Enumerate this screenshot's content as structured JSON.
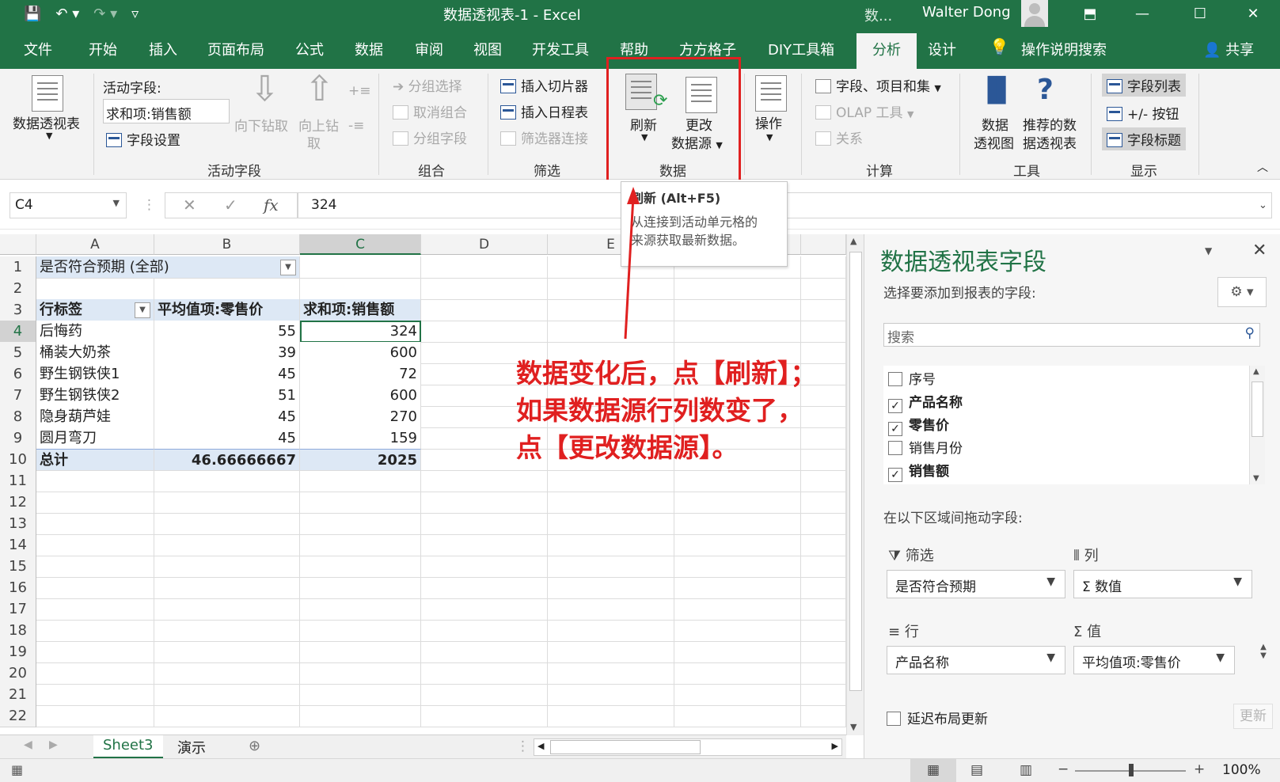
{
  "window": {
    "title": "数据透视表-1  -  Excel",
    "title_extra": "数...",
    "user": "Walter Dong"
  },
  "tabs": [
    "文件",
    "开始",
    "插入",
    "页面布局",
    "公式",
    "数据",
    "审阅",
    "视图",
    "开发工具",
    "帮助",
    "方方格子",
    "DIY工具箱",
    "分析",
    "设计",
    "操作说明搜索"
  ],
  "share_label": "共享",
  "ribbon": {
    "pivot_table_label": "数据透视表",
    "active_field_label": "活动字段:",
    "active_field_value": "求和项:销售额",
    "field_settings": "字段设置",
    "drill_down": "向下钻取",
    "drill_up": "向上钻",
    "drill_up_2": "取",
    "group_active_field": "活动字段",
    "group_selection": "分组选择",
    "ungroup": "取消组合",
    "group_field": "分组字段",
    "group_group": "组合",
    "insert_slicer": "插入切片器",
    "insert_timeline": "插入日程表",
    "filter_connections": "筛选器连接",
    "group_filter": "筛选",
    "refresh": "刷新",
    "change_source_1": "更改",
    "change_source_2": "数据源",
    "group_data": "数据",
    "actions": "操作",
    "fields_items_sets": "字段、项目和集",
    "olap_tools": "OLAP 工具",
    "relationships": "关系",
    "group_calc": "计算",
    "pivot_chart_1": "数据",
    "pivot_chart_2": "透视图",
    "recommended_1": "推荐的数",
    "recommended_2": "据透视表",
    "group_tools": "工具",
    "field_list": "字段列表",
    "buttons": "+/- 按钮",
    "field_headers": "字段标题",
    "group_show": "显示"
  },
  "tooltip": {
    "title": "刷新 (Alt+F5)",
    "line1": "从连接到活动单元格的",
    "line2": "来源获取最新数据。"
  },
  "formula_bar": {
    "name_box": "C4",
    "value": "324"
  },
  "sheet": {
    "columns": [
      "A",
      "B",
      "C",
      "D",
      "E"
    ],
    "rows": [
      "1",
      "2",
      "3",
      "4",
      "5",
      "6",
      "7",
      "8",
      "9",
      "10",
      "11",
      "12",
      "13",
      "14",
      "15",
      "16",
      "17",
      "18",
      "19",
      "20",
      "21",
      "22"
    ],
    "filter_label": "是否符合预期",
    "filter_value": "(全部)",
    "header": [
      "行标签",
      "平均值项:零售价",
      "求和项:销售额"
    ],
    "data": [
      [
        "后悔药",
        "55",
        "324"
      ],
      [
        "桶装大奶茶",
        "39",
        "600"
      ],
      [
        "野生钢铁侠1",
        "45",
        "72"
      ],
      [
        "野生钢铁侠2",
        "51",
        "600"
      ],
      [
        "隐身葫芦娃",
        "45",
        "270"
      ],
      [
        "圆月弯刀",
        "45",
        "159"
      ]
    ],
    "total": [
      "总计",
      "46.66666667",
      "2025"
    ]
  },
  "annotation": {
    "line1": "数据变化后，点【刷新】；",
    "line2": "如果数据源行列数变了，",
    "line3": "点【更改数据源】。",
    "color": "#e02020"
  },
  "sheet_tabs": [
    "Sheet3",
    "演示"
  ],
  "status": {
    "zoom": "100%"
  },
  "pivot_pane": {
    "title": "数据透视表字段",
    "subtitle": "选择要添加到报表的字段:",
    "search_placeholder": "搜索",
    "fields": [
      {
        "name": "序号",
        "checked": false
      },
      {
        "name": "产品名称",
        "checked": true
      },
      {
        "name": "零售价",
        "checked": true
      },
      {
        "name": "销售月份",
        "checked": false
      },
      {
        "name": "销售额",
        "checked": true
      }
    ],
    "drag_label": "在以下区域间拖动字段:",
    "areas": {
      "filters_label": "筛选",
      "filters_value": "是否符合预期",
      "columns_label": "列",
      "columns_value": "Σ 数值",
      "rows_label": "行",
      "rows_value": "产品名称",
      "values_label": "值",
      "values_value": "平均值项:零售价"
    },
    "defer_label": "延迟布局更新",
    "update_label": "更新"
  },
  "accent_color": "#217346"
}
